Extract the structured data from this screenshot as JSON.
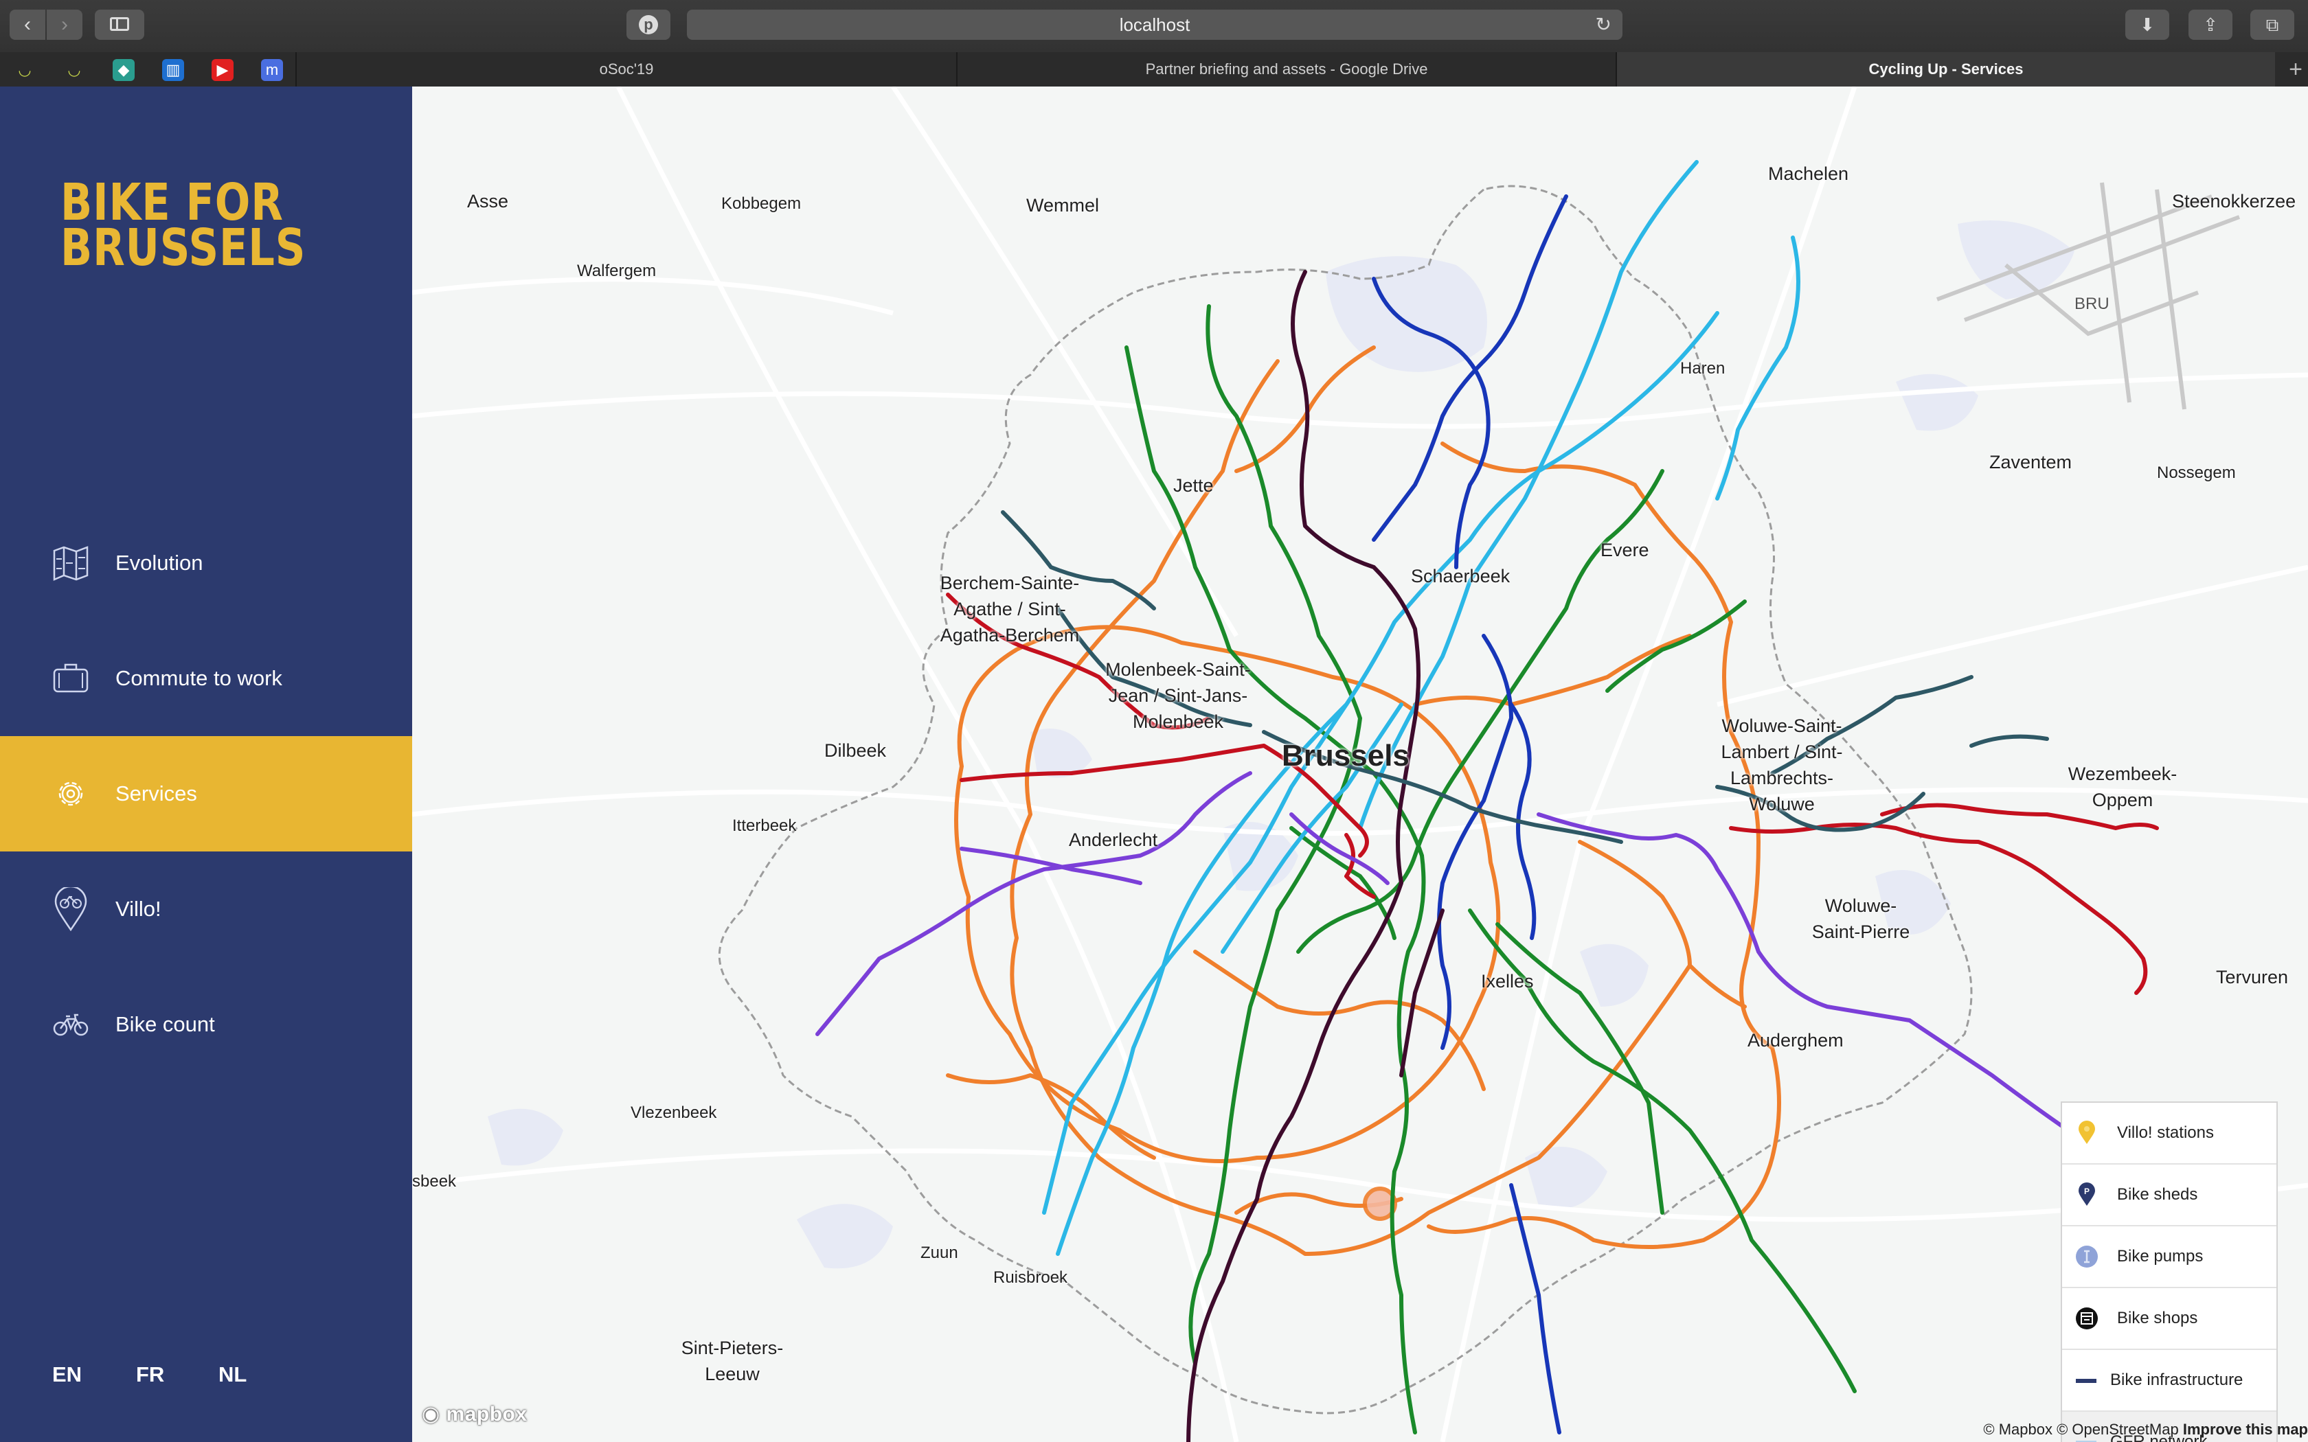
{
  "browser": {
    "url": "localhost",
    "tabs": [
      {
        "label": "oSoc'19"
      },
      {
        "label": "Partner briefing and assets - Google Drive"
      },
      {
        "label": "Cycling Up - Services"
      }
    ]
  },
  "app": {
    "logo_line1": "BIKE FOR",
    "logo_line2": "BRUSSELS",
    "nav": [
      {
        "label": "Evolution",
        "icon": "map-icon"
      },
      {
        "label": "Commute to work",
        "icon": "briefcase-icon"
      },
      {
        "label": "Services",
        "icon": "gear-icon",
        "active": true
      },
      {
        "label": "Villo!",
        "icon": "location-bike-icon"
      },
      {
        "label": "Bike count",
        "icon": "bicycle-icon"
      }
    ],
    "languages": [
      "EN",
      "FR",
      "NL"
    ],
    "colors": {
      "sidebar": "#2c3a6e",
      "accent": "#e8b632"
    }
  },
  "map": {
    "places": {
      "asse": "Asse",
      "kobbegem": "Kobbegem",
      "wemmel": "Wemmel",
      "walfergem": "Walfergem",
      "machelen": "Machelen",
      "steenokkerzeel": "Steenokkerzee",
      "bru": "BRU",
      "haren": "Haren",
      "zaventem": "Zaventem",
      "nossegem": "Nossegem",
      "jette": "Jette",
      "berchem": "Berchem-Sainte-Agathe / Sint-Agatha-Berchem",
      "schaerbeek": "Schaerbeek",
      "evere": "Evere",
      "molenbeek": "Molenbeek-Saint-Jean / Sint-Jans-Molenbeek",
      "brussels": "Brussels",
      "dilbeek": "Dilbeek",
      "woluwe_lambert": "Woluwe-Saint-Lambert / Sint-Lambrechts-Woluwe",
      "wezembeek": "Wezembeek-Oppem",
      "itterbeek": "Itterbeek",
      "anderlecht": "Anderlecht",
      "woluwe_pierre": "Woluwe-Saint-Pierre",
      "tervuren": "Tervuren",
      "ixelles": "Ixelles",
      "auderghem": "Auderghem",
      "vlezenbeek": "Vlezenbeek",
      "sbeek": "sbeek",
      "zuun": "Zuun",
      "ruisbroek": "Ruisbroek",
      "sint_pieters": "Sint-Pieters-Leeuw"
    },
    "legend": [
      {
        "label": "Villo! stations",
        "icon": "villo-marker-icon",
        "color": "#f1c232"
      },
      {
        "label": "Bike sheds",
        "icon": "parking-marker-icon",
        "color": "#2c3a6e"
      },
      {
        "label": "Bike pumps",
        "icon": "pump-icon",
        "color": "#8fa3d8"
      },
      {
        "label": "Bike shops",
        "icon": "shop-icon",
        "color": "#111111"
      },
      {
        "label": "Bike infrastructure",
        "icon": "infrastructure-line-icon",
        "color": "#2c3a6e"
      },
      {
        "label": "GFR network",
        "icon": "gfr-line-icon",
        "color": "#b5d2ea"
      }
    ],
    "attribution": "© Mapbox © OpenStreetMap",
    "improve": "Improve this map",
    "mapbox_logo": "mapbox",
    "route_colors": [
      "#f07f2c",
      "#1a8a2a",
      "#2bb7e6",
      "#1736b8",
      "#c4101e",
      "#7b3fd8",
      "#3e0b2c",
      "#2e5865"
    ]
  }
}
